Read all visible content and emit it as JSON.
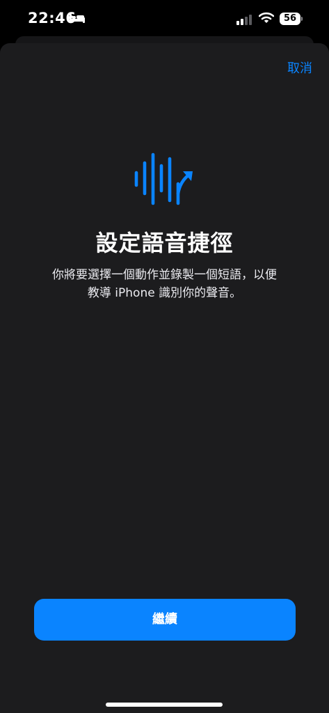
{
  "status_bar": {
    "time": "22:46",
    "battery_level": "56",
    "icons": [
      "sleep-icon",
      "cellular-signal-icon",
      "wifi-icon",
      "battery-icon"
    ]
  },
  "sheet": {
    "cancel_label": "取消",
    "icon": "voice-shortcut-waveform-icon",
    "title": "設定語音捷徑",
    "description_lines": [
      "你將要選擇一個動作並錄製一個短語，以便",
      "教導 iPhone 識別你的聲音。"
    ],
    "continue_label": "繼續"
  },
  "colors": {
    "accent": "#0a84ff",
    "sheet_background": "#1c1c1e",
    "screen_background": "#000000"
  }
}
